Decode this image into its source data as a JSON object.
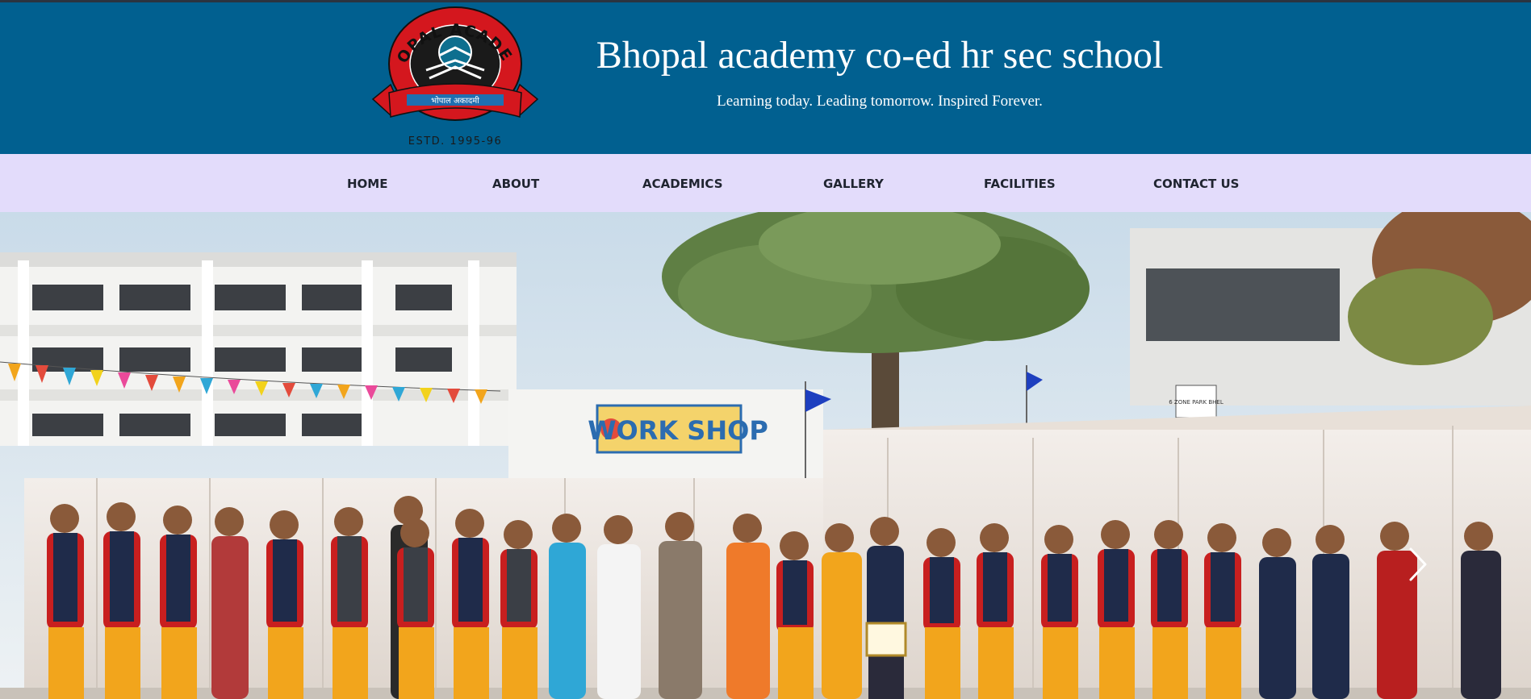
{
  "header": {
    "logo": {
      "arc_text": "BHOPAL ACADEMY",
      "banner_text": "भोपाल अकादमी",
      "estd_text": "ESTD. 1995-96"
    },
    "title": "Bhopal academy co-ed hr sec school",
    "tagline": "Learning today. Leading tomorrow. Inspired Forever."
  },
  "nav": {
    "items": [
      {
        "label": "HOME"
      },
      {
        "label": "ABOUT"
      },
      {
        "label": "ACADEMICS"
      },
      {
        "label": "GALLERY"
      },
      {
        "label": "FACILITIES"
      },
      {
        "label": "CONTACT US"
      }
    ]
  },
  "hero": {
    "workshop_sign": "WORK SHOP",
    "small_sign": "6 ZONE PARK BHEL",
    "next_icon": "chevron-right-icon"
  },
  "colors": {
    "header_bg": "#016090",
    "nav_bg": "#e3dcfb",
    "logo_red": "#d4171e",
    "uniform_orange": "#f2a51c",
    "uniform_vest": "#1f2b4a"
  }
}
